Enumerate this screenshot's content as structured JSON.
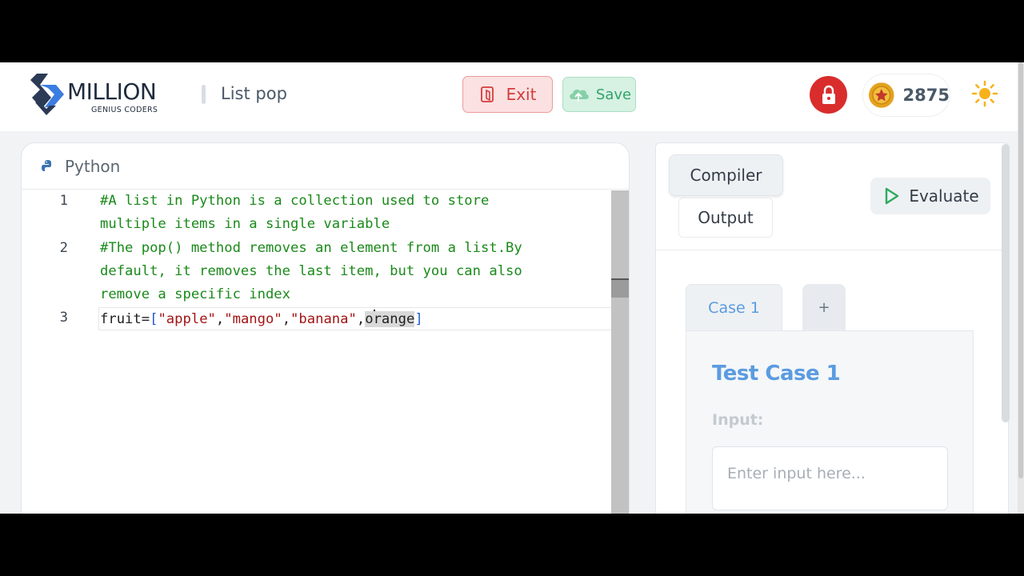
{
  "brand": {
    "name": "MILLION",
    "tagline": "GENIUS CODERS"
  },
  "header": {
    "page_title": "List pop",
    "exit_label": "Exit",
    "save_label": "Save",
    "coins": "2875"
  },
  "editor": {
    "language": "Python",
    "lines": [
      {
        "number": "1",
        "text_1": "#A list in Python is a collection used to store",
        "text_2": "multiple items in a single variable"
      },
      {
        "number": "2",
        "text_1": "#The pop() method removes an element from a list.By",
        "text_2": "default, it removes the last item, but you can also",
        "text_3": "remove a specific index"
      },
      {
        "number": "3",
        "tokens": {
          "name": "fruit=",
          "open": "[",
          "s1": "\"apple\"",
          "c1": ",",
          "s2": "\"mango\"",
          "c2": ",",
          "s3": "\"banana\"",
          "c3": ",",
          "o": "o",
          "rest": "range",
          "close": "]"
        }
      }
    ]
  },
  "right_panel": {
    "compiler_tab": "Compiler",
    "output_tab": "Output",
    "evaluate_label": "Evaluate",
    "case_tab": "Case 1",
    "add_case": "+",
    "case_title": "Test Case 1",
    "input_label": "Input:",
    "input_placeholder": "Enter input here...",
    "input_value": ""
  },
  "colors": {
    "exit_red": "#d43c3c",
    "save_green": "#33a36a",
    "accent_blue": "#5b9be0",
    "comment_green": "#1a8a1a",
    "string_red": "#a31515"
  },
  "icons": {
    "lock": "lock-icon",
    "coin": "coin-icon",
    "theme": "sun-icon",
    "exit": "door-exit-icon",
    "save": "cloud-upload-icon",
    "evaluate": "play-icon",
    "language": "python-icon"
  }
}
